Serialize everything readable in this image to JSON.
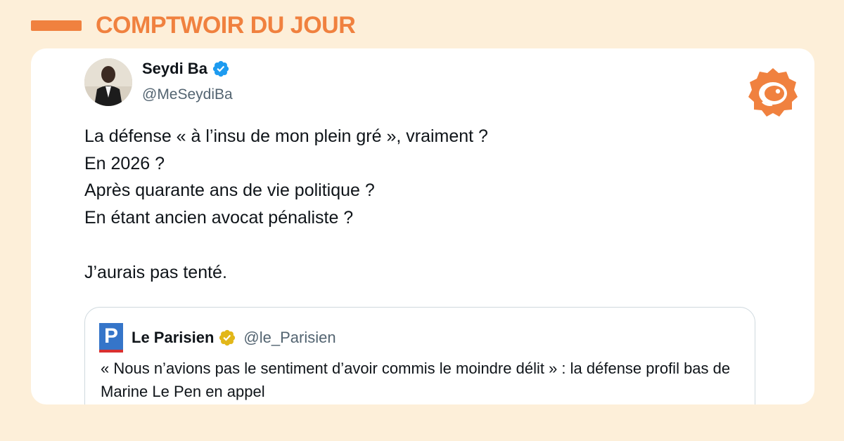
{
  "header": {
    "title": "COMPTWOIR DU JOUR"
  },
  "tweet": {
    "author": {
      "name": "Seydi Ba",
      "handle": "@MeSeydiBa",
      "verified_badge": "blue-check-icon"
    },
    "lines": [
      "La défense « à l’insu de mon plein gré », vraiment ?",
      "En 2026 ?",
      "Après quarante ans de vie politique ?",
      "En étant ancien avocat pénaliste ?",
      "",
      "J’aurais pas tenté."
    ],
    "quoted": {
      "logo_letter": "P",
      "name": "Le Parisien",
      "handle": "@le_Parisien",
      "badge": "gold-check-icon",
      "text": "« Nous n’avions pas le sentiment d’avoir commis le moindre délit » : la défense profil bas de Marine Le Pen en appel"
    }
  },
  "colors": {
    "background": "#fdefd9",
    "accent": "#f0813f",
    "verified_blue": "#1d9bf0",
    "gold": "#e2b719",
    "parisien_blue": "#3575c9",
    "parisien_red": "#d93030"
  }
}
